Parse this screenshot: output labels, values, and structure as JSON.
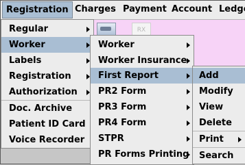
{
  "menubar": {
    "items": [
      "Registration",
      "Charges",
      "Payment",
      "Account",
      "Ledger"
    ]
  },
  "toolbar": {
    "rx_label": "RX"
  },
  "menu_registration": {
    "items": [
      "Regular",
      "Worker",
      "Labels",
      "Registration",
      "Authorization",
      "Doc. Archive",
      "Patient ID Card",
      "Voice Recorder"
    ]
  },
  "menu_worker": {
    "items": [
      "Worker",
      "Worker Insurance",
      "First Report",
      "PR2 Form",
      "PR3 Form",
      "PR4 Form",
      "STPR",
      "PR Forms Printing"
    ]
  },
  "menu_first_report": {
    "items": [
      "Add",
      "Modify",
      "View",
      "Delete",
      "Print",
      "Search"
    ]
  },
  "colors": {
    "highlight": "#a9bed3",
    "menu_bg": "#ececec",
    "background_pink": "#f7d3f7"
  }
}
